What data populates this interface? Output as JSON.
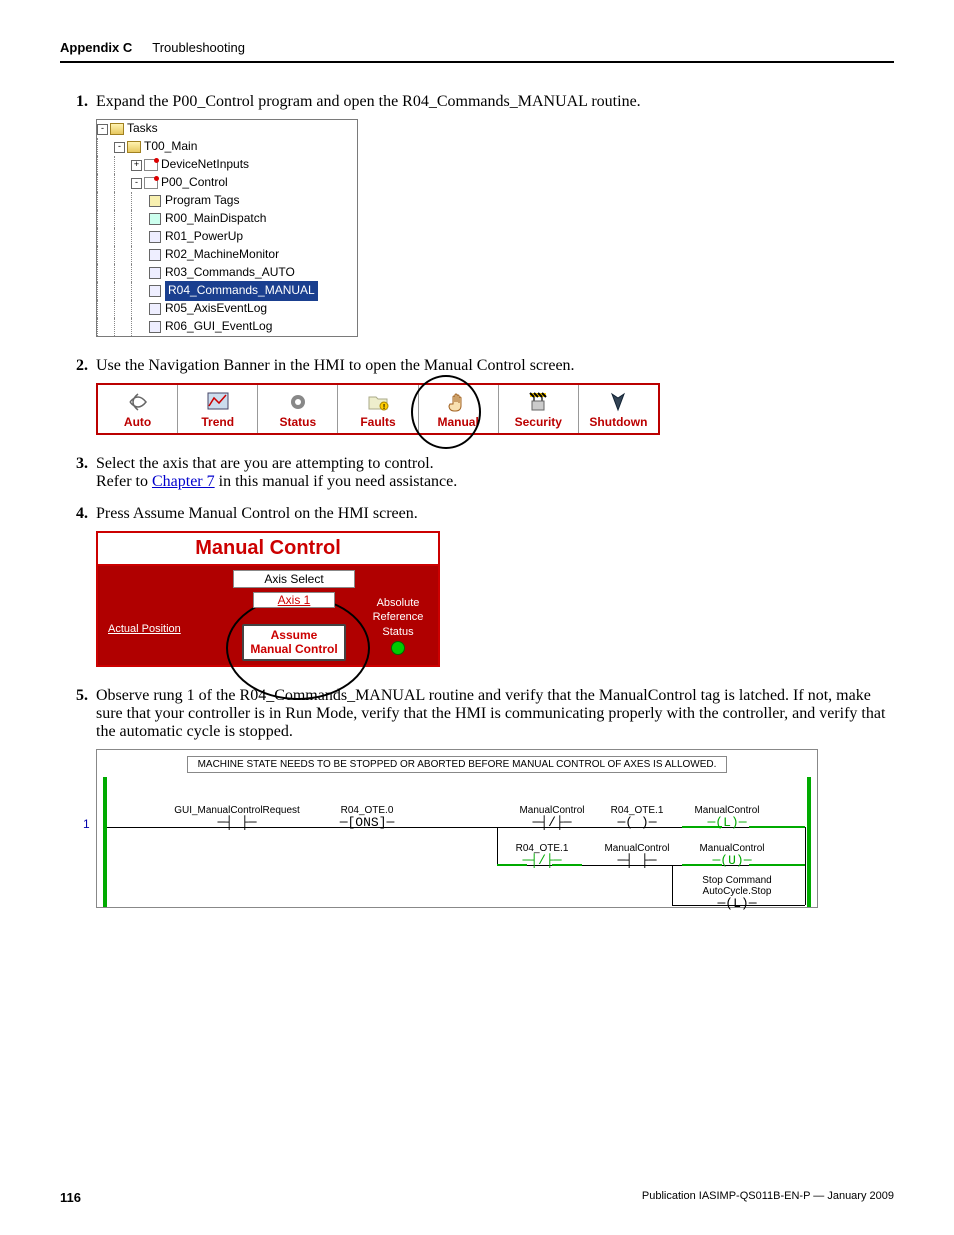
{
  "header": {
    "appendix": "Appendix C",
    "title": "Troubleshooting"
  },
  "steps": {
    "s1": {
      "n": "1.",
      "t": "Expand the P00_Control program and open the R04_Commands_MANUAL routine."
    },
    "s2": {
      "n": "2.",
      "t": "Use the Navigation Banner in the HMI to open the Manual Control screen."
    },
    "s3": {
      "n": "3.",
      "ta": "Select the axis that are you are attempting to control.",
      "tb1": "Refer to ",
      "link": "Chapter 7",
      "tb2": " in this manual if you need assistance."
    },
    "s4": {
      "n": "4.",
      "t": "Press Assume Manual Control on the HMI screen."
    },
    "s5": {
      "n": "5.",
      "t": "Observe rung 1 of the R04_Commands_MANUAL routine and verify that the ManualControl tag is latched. If not, make sure that your controller is in Run Mode, verify that the HMI is communicating properly with the controller, and verify that the automatic cycle is stopped."
    }
  },
  "tree": {
    "root": "Tasks",
    "main": "T00_Main",
    "items": [
      "DeviceNetInputs",
      "P00_Control",
      "Program Tags",
      "R00_MainDispatch",
      "R01_PowerUp",
      "R02_MachineMonitor",
      "R03_Commands_AUTO",
      "R04_Commands_MANUAL",
      "R05_AxisEventLog",
      "R06_GUI_EventLog"
    ]
  },
  "nav": [
    "Auto",
    "Trend",
    "Status",
    "Faults",
    "Manual",
    "Security",
    "Shutdown"
  ],
  "mc": {
    "title": "Manual Control",
    "axis_lbl": "Axis Select",
    "axis": "Axis 1",
    "assume1": "Assume",
    "assume2": "Manual Control",
    "ref1": "Absolute",
    "ref2": "Reference",
    "ref3": "Status",
    "actual": "Actual Position"
  },
  "ladder": {
    "note": "MACHINE STATE NEEDS TO BE STOPPED OR ABORTED BEFORE MANUAL CONTROL OF AXES IS ALLOWED.",
    "rung": "1",
    "e1": "GUI_ManualControlRequest",
    "e2": "R04_OTE.0",
    "ons": "ONS",
    "e3": "ManualControl",
    "e4": "R04_OTE.1",
    "e5": "ManualControl",
    "e6": "R04_OTE.1",
    "e7": "ManualControl",
    "e8": "ManualControl",
    "e9a": "Stop Command",
    "e9b": "AutoCycle.Stop"
  },
  "footer": {
    "page": "116",
    "pub": "Publication IASIMP-QS011B-EN-P — January 2009"
  }
}
